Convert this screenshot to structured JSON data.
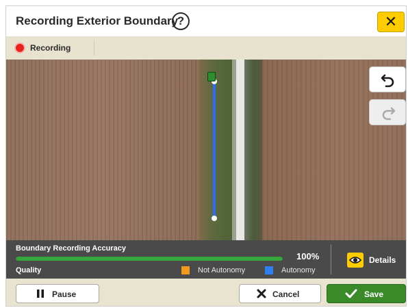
{
  "header": {
    "title": "Recording Exterior Boundary",
    "help_glyph": "?",
    "close_glyph": "✕"
  },
  "status": {
    "recording_label": "Recording"
  },
  "map": {
    "undo_icon": "undo-icon",
    "redo_icon": "redo-icon",
    "redo_enabled": false
  },
  "accuracy": {
    "title": "Boundary Recording Accuracy",
    "percent_text": "100%",
    "percent_value": 100,
    "quality_label": "Quality",
    "legend": [
      {
        "label": "Not Autonomy",
        "color": "#f39a1e"
      },
      {
        "label": "Autonomy",
        "color": "#2f7ff2"
      }
    ],
    "details_label": "Details"
  },
  "footer": {
    "pause_label": "Pause",
    "cancel_label": "Cancel",
    "save_label": "Save"
  },
  "colors": {
    "accent_yellow": "#ffcc00",
    "save_green": "#3a8a2a",
    "recording_red": "#e8231b",
    "boundary_blue": "#2f6ef2"
  }
}
